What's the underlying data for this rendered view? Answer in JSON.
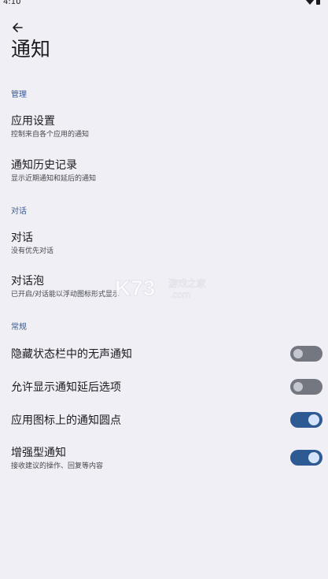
{
  "status_bar": {
    "time": "4:10"
  },
  "header": {
    "title": "通知"
  },
  "sections": {
    "manage": {
      "header": "管理",
      "app_settings": {
        "title": "应用设置",
        "summary": "控制来自各个应用的通知"
      },
      "history": {
        "title": "通知历史记录",
        "summary": "显示近期通知和延后的通知"
      }
    },
    "conversation": {
      "header": "对话",
      "conversations": {
        "title": "对话",
        "summary": "没有优先对话"
      },
      "bubbles": {
        "title": "对话泡",
        "summary": "已开启/对话能以浮动图标形式显示"
      }
    },
    "general": {
      "header": "常规",
      "hide_silent": {
        "title": "隐藏状态栏中的无声通知",
        "enabled": false
      },
      "snooze": {
        "title": "允许显示通知延后选项",
        "enabled": false
      },
      "badge_dots": {
        "title": "应用图标上的通知圆点",
        "enabled": true
      },
      "enhanced": {
        "title": "增强型通知",
        "summary": "接收建议的操作、回复等内容",
        "enabled": true
      }
    }
  },
  "colors": {
    "background": "#f0eff6",
    "accent": "#3c5a92",
    "switch_on": "#2e5a94",
    "switch_off": "#74777f"
  },
  "watermark": {
    "brand": "K73",
    "domain": ".com",
    "slogan": "游戏之家"
  }
}
